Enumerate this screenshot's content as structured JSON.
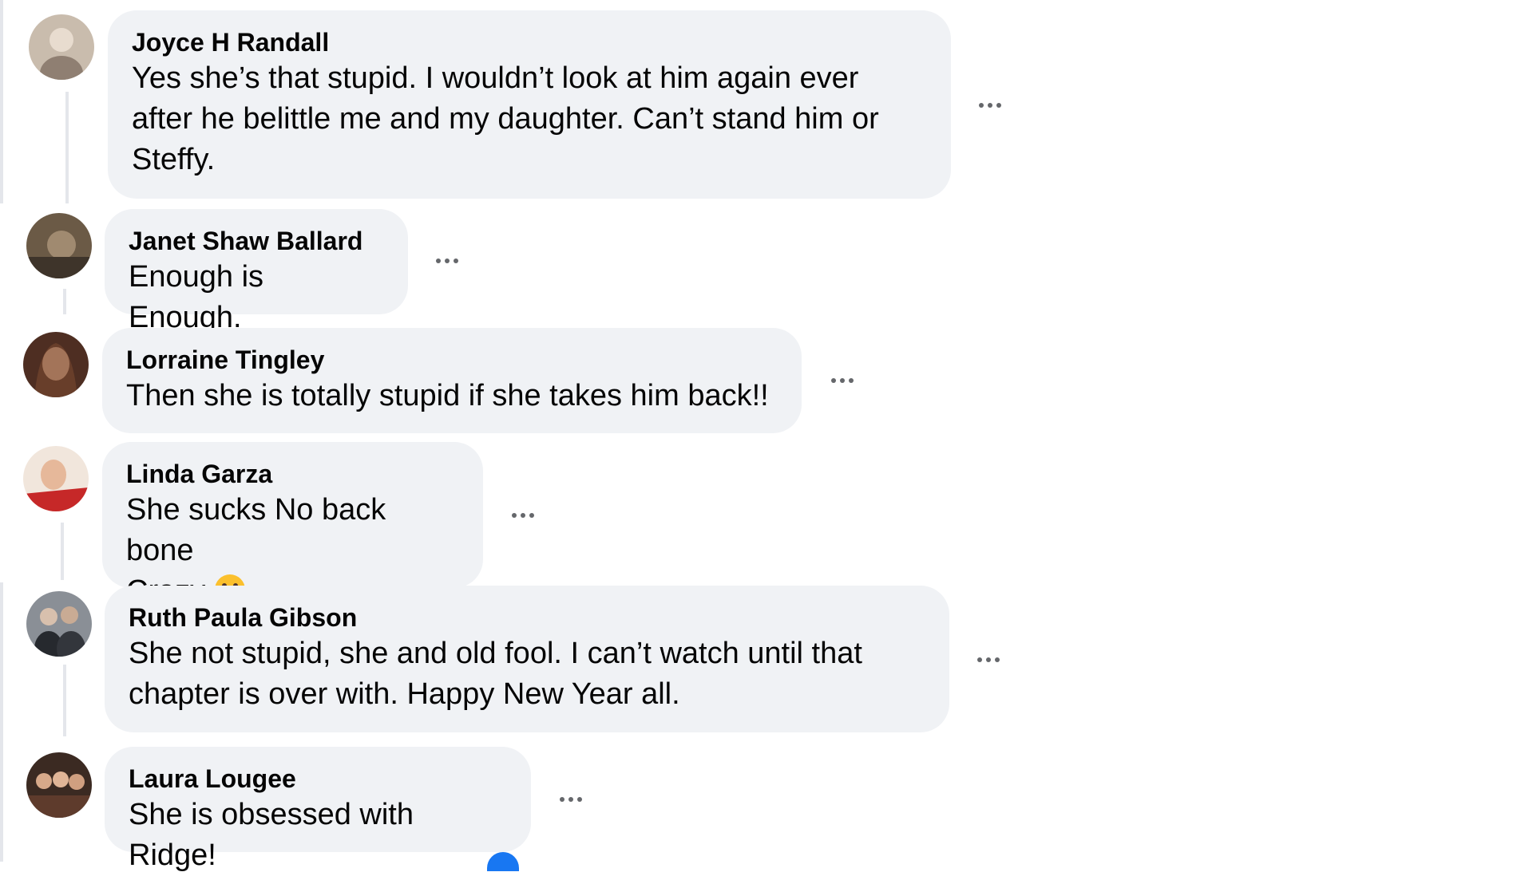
{
  "comments": [
    {
      "author": "Joyce H Randall",
      "text": "Yes she’s that stupid. I wouldn’t look at him again ever after he belittle me and my daughter. Can’t stand him or Steffy.",
      "avatar_color": "#b8a89a"
    },
    {
      "author": "Janet Shaw Ballard",
      "text": "Enough is Enough.",
      "avatar_color": "#6b5a46"
    },
    {
      "author": "Lorraine Tingley",
      "text": "Then she is totally stupid if she takes him back!!",
      "avatar_color": "#8a5a3e"
    },
    {
      "author": "Linda Garza",
      "text": "She sucks No back bone\nCrazy",
      "emoji": "grimacing-face-emoji",
      "avatar_color": "#b23a3a"
    },
    {
      "author": "Ruth Paula Gibson",
      "text": "She not stupid, she and old fool. I can’t watch until that chapter is over with. Happy New Year all.",
      "avatar_color": "#4a4e55"
    },
    {
      "author": "Laura Lougee",
      "text": "She is obsessed with Ridge!",
      "avatar_color": "#5a3a2e"
    }
  ],
  "colors": {
    "bubble": "#f0f2f5",
    "thread_line": "#e4e6eb",
    "more_icon": "#65676b",
    "accent": "#1877f2"
  }
}
